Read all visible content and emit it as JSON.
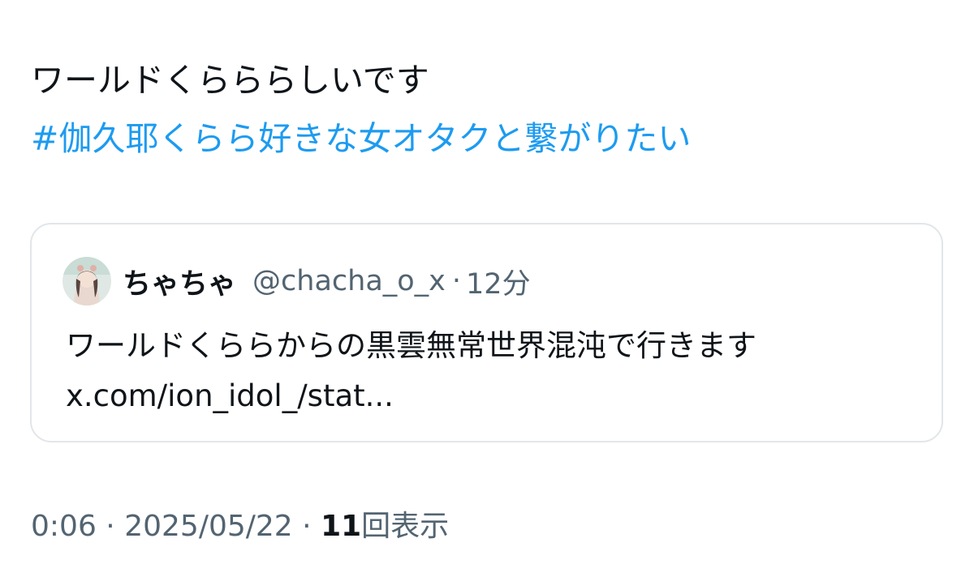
{
  "post": {
    "text": "ワールドくらららしいです",
    "hashtag": "#伽久耶くらら好きな女オタクと繋がりたい"
  },
  "quote": {
    "author_name": "ちゃちゃ",
    "author_handle": "@chacha_o_x",
    "separator": "·",
    "time_ago": "12分",
    "text": "ワールドくららからの黒雲無常世界混沌で行きます",
    "link": "x.com/ion_idol_/stat..."
  },
  "meta": {
    "time": "0:06",
    "separator": "·",
    "date": "2025/05/22",
    "separator2": "·",
    "views_count": "11",
    "views_label": "回表示"
  },
  "colors": {
    "text": "#0f1419",
    "secondary": "#536471",
    "hashtag": "#1d9bf0",
    "border": "#e1e6ea"
  }
}
